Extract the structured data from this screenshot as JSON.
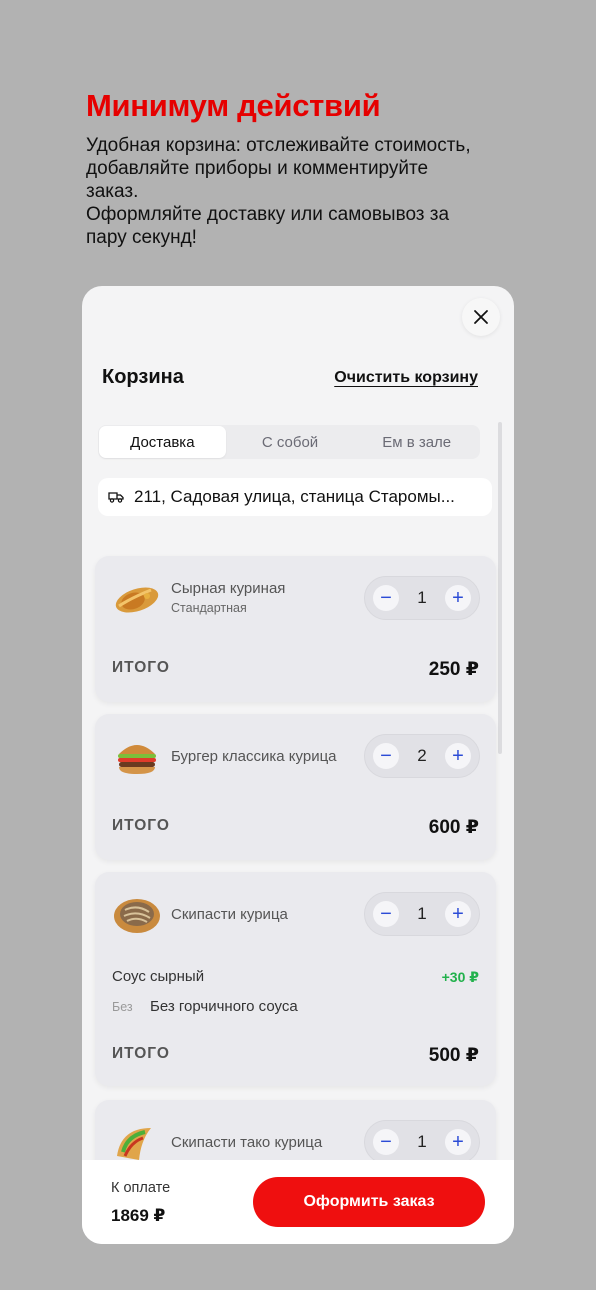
{
  "promo": {
    "title": "Минимум действий",
    "description": "Удобная корзина: отслеживайте стоимость,\nдобавляйте приборы и комментируйте\nзаказ.\nОформляйте доставку или самовывоз за\nпару секунд!"
  },
  "cart": {
    "title": "Корзина",
    "clear_label": "Очистить корзину",
    "tabs": [
      {
        "label": "Доставка",
        "active": true
      },
      {
        "label": "С собой",
        "active": false
      },
      {
        "label": "Ем в зале",
        "active": false
      }
    ],
    "address": "211, Садовая улица, станица Старомы...",
    "total_label": "ИТОГО",
    "items": [
      {
        "name": "Сырная куриная",
        "variant": "Стандартная",
        "qty": "1",
        "total": "250 ₽",
        "thumb_icon": "shawarma-icon"
      },
      {
        "name": "Бургер классика курица",
        "qty": "2",
        "total": "600 ₽",
        "thumb_icon": "burger-icon"
      },
      {
        "name": "Скипасти курица",
        "qty": "1",
        "total": "500 ₽",
        "thumb_icon": "pasta-plate-icon",
        "modifier": {
          "name": "Соус сырный",
          "price": "+30 ₽"
        },
        "without": {
          "label": "Без",
          "name": "Без горчичного соуса"
        }
      },
      {
        "name": "Скипасти тако курица",
        "qty": "1",
        "thumb_icon": "taco-icon"
      }
    ]
  },
  "footer": {
    "pay_label": "К оплате",
    "pay_value": "1869 ₽",
    "checkout_label": "Оформить заказ"
  },
  "colors": {
    "accent": "#e60000",
    "button": "#ef0f0f",
    "stepper_icon": "#2b4bd6",
    "modifier_price": "#22b14c",
    "background": "#b2b2b2"
  }
}
